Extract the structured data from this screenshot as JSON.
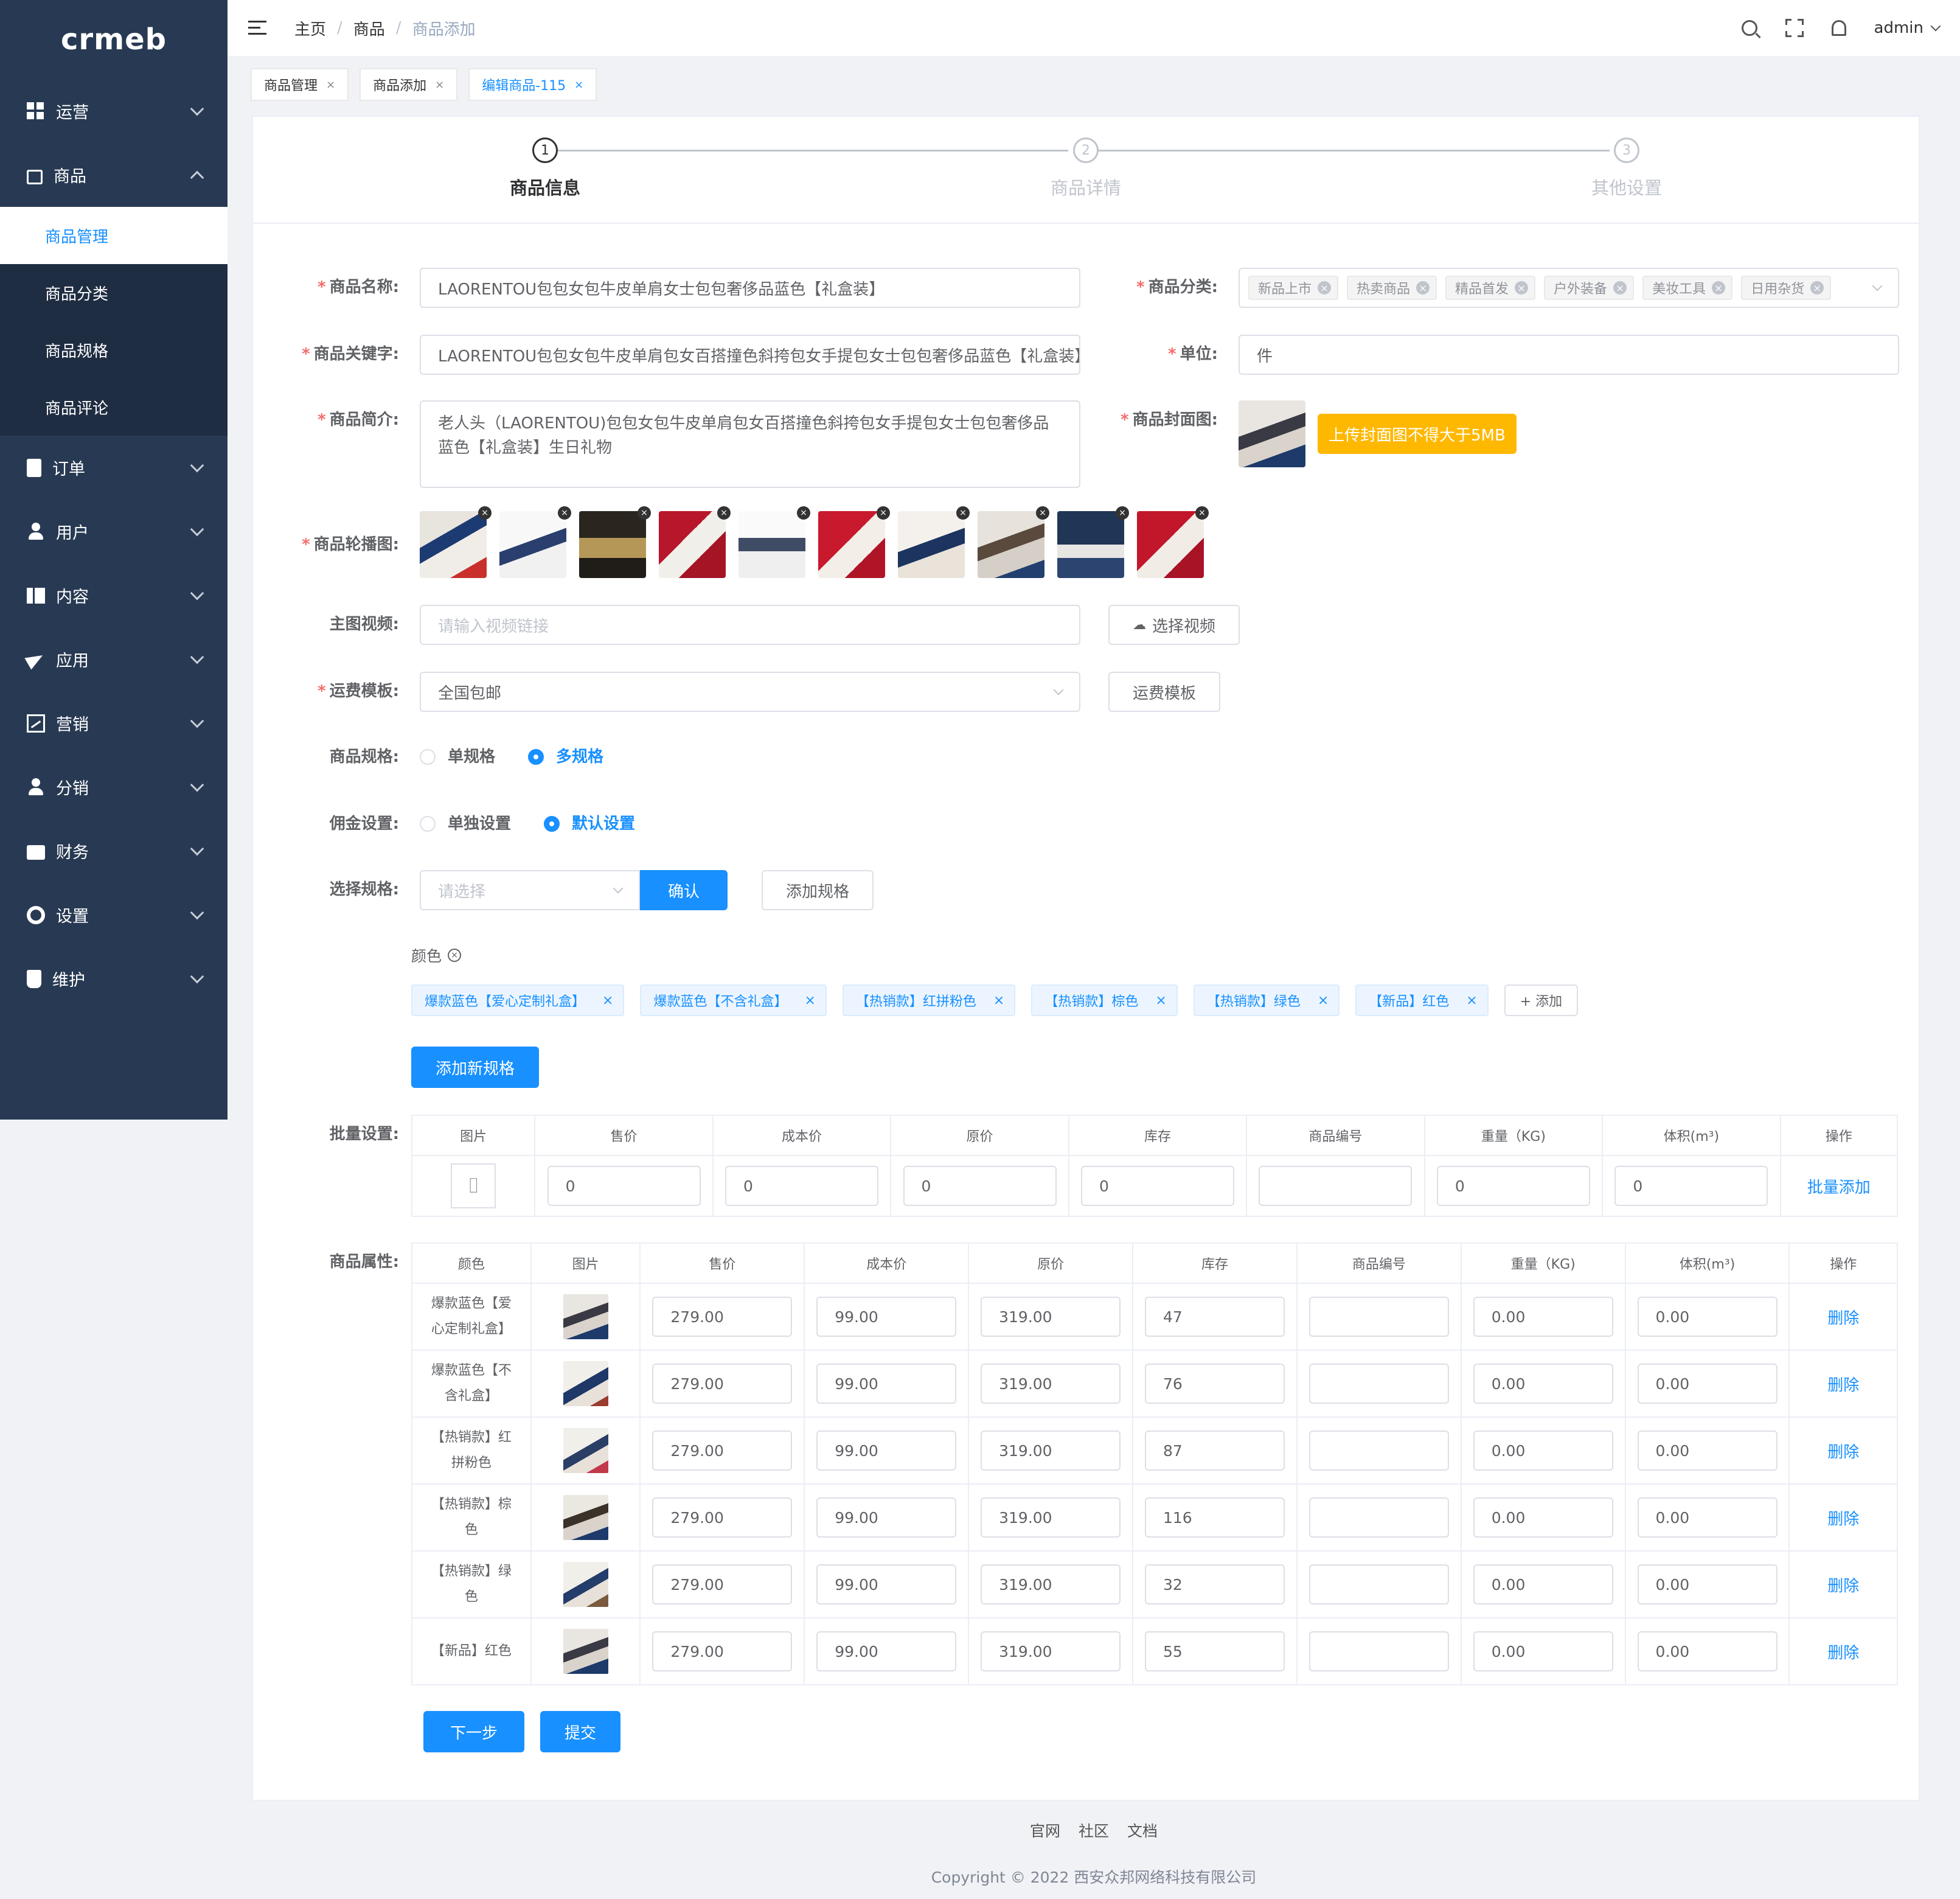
{
  "brand": {
    "logo": "crmeb"
  },
  "sidebar": {
    "items": [
      {
        "label": "运营",
        "icon": "dashboard-icon"
      },
      {
        "label": "商品",
        "icon": "bag-icon",
        "open": true
      },
      {
        "label": "订单",
        "icon": "order-icon"
      },
      {
        "label": "用户",
        "icon": "user-icon"
      },
      {
        "label": "内容",
        "icon": "book-icon"
      },
      {
        "label": "应用",
        "icon": "send-icon"
      },
      {
        "label": "营销",
        "icon": "chart-icon"
      },
      {
        "label": "分销",
        "icon": "person-icon"
      },
      {
        "label": "财务",
        "icon": "wallet-icon"
      },
      {
        "label": "设置",
        "icon": "gear-icon"
      },
      {
        "label": "维护",
        "icon": "cup-icon"
      }
    ],
    "submenu": [
      "商品管理",
      "商品分类",
      "商品规格",
      "商品评论"
    ],
    "active_sub": "商品管理"
  },
  "header": {
    "breadcrumb": [
      "主页",
      "商品",
      "商品添加"
    ],
    "user": "admin"
  },
  "tabs": [
    "商品管理",
    "商品添加",
    "编辑商品-115"
  ],
  "steps": [
    {
      "num": "1",
      "label": "商品信息"
    },
    {
      "num": "2",
      "label": "商品详情"
    },
    {
      "num": "3",
      "label": "其他设置"
    }
  ],
  "form": {
    "name_label": "商品名称:",
    "name_value": "LAORENTOU包包女包牛皮单肩女士包包奢侈品蓝色【礼盒装】",
    "category_label": "商品分类:",
    "categories": [
      "新品上市",
      "热卖商品",
      "精品首发",
      "户外装备",
      "美妆工具",
      "日用杂货"
    ],
    "keyword_label": "商品关键字:",
    "keyword_value": "LAORENTOU包包女包牛皮单肩包女百搭撞色斜挎包女手提包女士包包奢侈品蓝色【礼盒装】",
    "unit_label": "单位:",
    "unit_value": "件",
    "intro_label": "商品简介:",
    "intro_value": "老人头（LAORENTOU)包包女包牛皮单肩包女百搭撞色斜挎包女手提包女士包包奢侈品蓝色【礼盒装】生日礼物",
    "cover_label": "商品封面图:",
    "cover_button": "上传封面图不得大于5MB",
    "carousel_label": "商品轮播图:",
    "video_label": "主图视频:",
    "video_placeholder": "请输入视频链接",
    "video_button": "选择视频",
    "shipping_label": "运费模板:",
    "shipping_value": "全国包邮",
    "shipping_button": "运费模板",
    "spec_label": "商品规格:",
    "spec_options": [
      "单规格",
      "多规格"
    ],
    "commission_label": "佣金设置:",
    "commission_options": [
      "单独设置",
      "默认设置"
    ],
    "choose_spec_label": "选择规格:",
    "choose_spec_placeholder": "请选择",
    "confirm_button": "确认",
    "add_spec_button": "添加规格",
    "spec_group_name": "颜色",
    "spec_values": [
      "爆款蓝色【爱心定制礼盒】",
      "爆款蓝色【不含礼盒】",
      "【热销款】红拼粉色",
      "【热销款】棕色",
      "【热销款】绿色",
      "【新品】红色"
    ],
    "add_value_button": "+ 添加",
    "add_new_spec_button": "添加新规格"
  },
  "batch": {
    "label": "批量设置:",
    "headers": [
      "图片",
      "售价",
      "成本价",
      "原价",
      "库存",
      "商品编号",
      "重量（KG)",
      "体积(m³)",
      "操作"
    ],
    "values": [
      "0",
      "0",
      "0",
      "0",
      "",
      "0",
      "0"
    ],
    "action": "批量添加"
  },
  "attrs": {
    "label": "商品属性:",
    "headers": [
      "颜色",
      "图片",
      "售价",
      "成本价",
      "原价",
      "库存",
      "商品编号",
      "重量（KG)",
      "体积(m³)",
      "操作"
    ],
    "rows": [
      {
        "color": "爆款蓝色【爱心定制礼盒】",
        "price": "279.00",
        "cost": "99.00",
        "orig": "319.00",
        "stock": "47",
        "code": "",
        "weight": "0.00",
        "volume": "0.00",
        "action": "删除"
      },
      {
        "color": "爆款蓝色【不含礼盒】",
        "price": "279.00",
        "cost": "99.00",
        "orig": "319.00",
        "stock": "76",
        "code": "",
        "weight": "0.00",
        "volume": "0.00",
        "action": "删除"
      },
      {
        "color": "【热销款】红拼粉色",
        "price": "279.00",
        "cost": "99.00",
        "orig": "319.00",
        "stock": "87",
        "code": "",
        "weight": "0.00",
        "volume": "0.00",
        "action": "删除"
      },
      {
        "color": "【热销款】棕色",
        "price": "279.00",
        "cost": "99.00",
        "orig": "319.00",
        "stock": "116",
        "code": "",
        "weight": "0.00",
        "volume": "0.00",
        "action": "删除"
      },
      {
        "color": "【热销款】绿色",
        "price": "279.00",
        "cost": "99.00",
        "orig": "319.00",
        "stock": "32",
        "code": "",
        "weight": "0.00",
        "volume": "0.00",
        "action": "删除"
      },
      {
        "color": "【新品】红色",
        "price": "279.00",
        "cost": "99.00",
        "orig": "319.00",
        "stock": "55",
        "code": "",
        "weight": "0.00",
        "volume": "0.00",
        "action": "删除"
      }
    ]
  },
  "actions": {
    "next": "下一步",
    "submit": "提交"
  },
  "footer": {
    "links": [
      "官网",
      "社区",
      "文档"
    ],
    "copyright": "Copyright © 2022 西安众邦网络科技有限公司"
  },
  "colors": {
    "primary": "#1890ff",
    "sidebar": "#283a53",
    "warning": "#ffb800",
    "required": "#f56c6c"
  }
}
